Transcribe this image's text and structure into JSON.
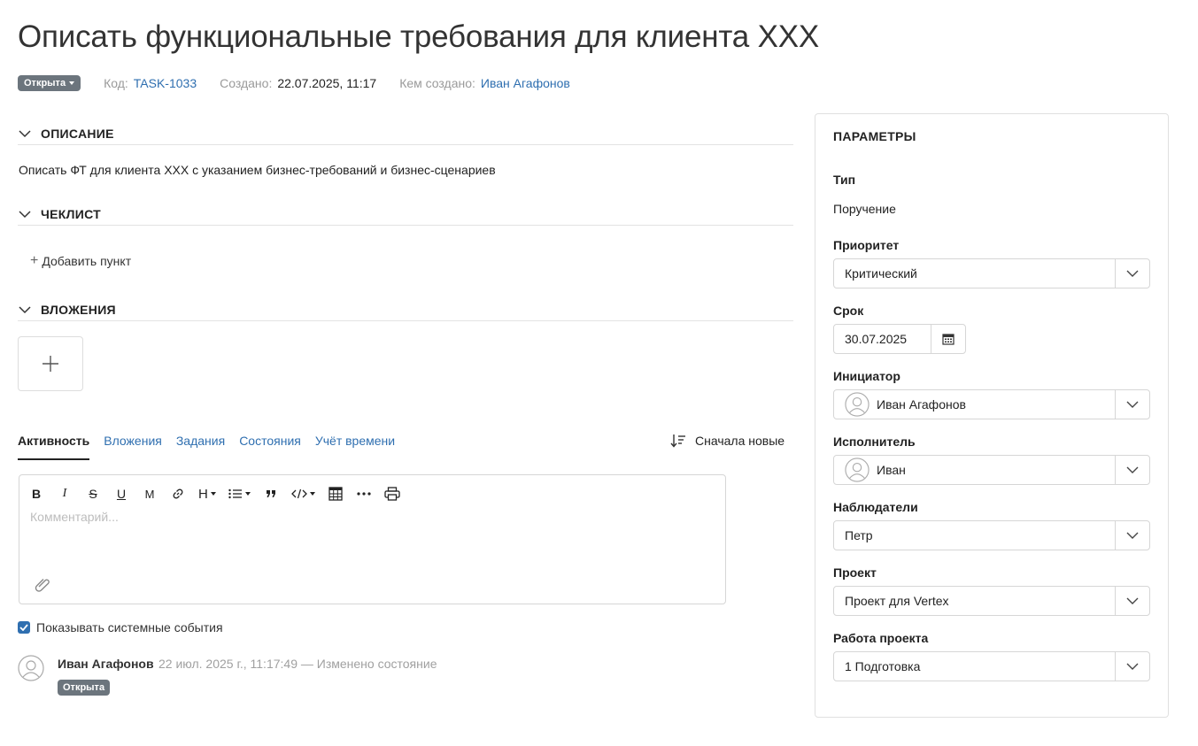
{
  "task": {
    "title": "Описать функциональные требования для клиента XXX",
    "status": "Открыта",
    "code_label": "Код:",
    "code": "TASK-1033",
    "created_label": "Создано:",
    "created": "22.07.2025, 11:17",
    "author_label": "Кем создано:",
    "author": "Иван Агафонов"
  },
  "sections": {
    "description_title": "ОПИСАНИЕ",
    "description_text": "Описать ФТ для клиента XXX с указанием бизнес-требований и бизнес-сценариев",
    "checklist_title": "ЧЕКЛИСТ",
    "checklist_add": "Добавить пункт",
    "attachments_title": "ВЛОЖЕНИЯ"
  },
  "activity": {
    "tabs": [
      "Активность",
      "Вложения",
      "Задания",
      "Состояния",
      "Учёт времени"
    ],
    "sort_label": "Сначала новые",
    "editor_placeholder": "Комментарий...",
    "show_system_events": "Показывать системные события",
    "show_system_events_checked": true,
    "entries": [
      {
        "author": "Иван Агафонов",
        "meta": "22 июл. 2025 г., 11:17:49 — Изменено состояние",
        "badge": "Открыта"
      }
    ]
  },
  "toolbar": {
    "bold": "B",
    "italic": "I",
    "strike": "S",
    "underline": "U",
    "mark": "M",
    "heading": "H"
  },
  "params": {
    "title": "ПАРАМЕТРЫ",
    "type_label": "Тип",
    "type_value": "Поручение",
    "priority_label": "Приоритет",
    "priority_value": "Критический",
    "due_label": "Срок",
    "due_value": "30.07.2025",
    "initiator_label": "Инициатор",
    "initiator_value": "Иван Агафонов",
    "assignee_label": "Исполнитель",
    "assignee_value": "Иван",
    "watchers_label": "Наблюдатели",
    "watchers_value": "Петр",
    "project_label": "Проект",
    "project_value": "Проект для Vertex",
    "work_label": "Работа проекта",
    "work_value": "1 Подготовка"
  },
  "colors": {
    "accent": "#2f6fb0",
    "badge": "#6c757d",
    "border": "#d6d6d6"
  }
}
